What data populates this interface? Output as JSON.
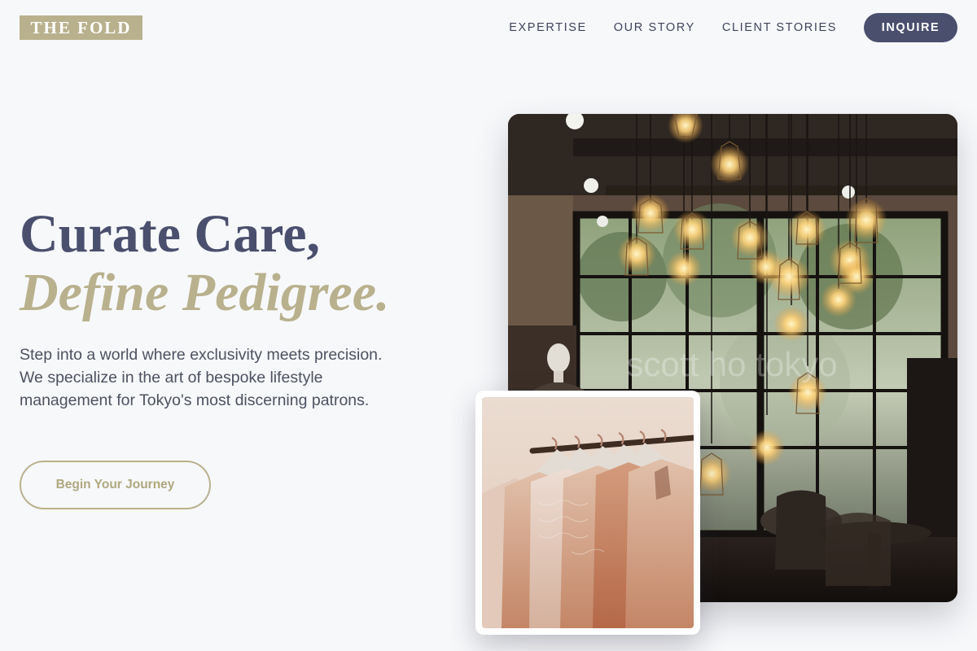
{
  "header": {
    "logo": "THE FOLD",
    "nav": [
      {
        "label": "EXPERTISE"
      },
      {
        "label": "OUR STORY"
      },
      {
        "label": "CLIENT STORIES"
      }
    ],
    "cta": "INQUIRE"
  },
  "hero": {
    "title_line1": "Curate Care,",
    "title_line2": "Define Pedigree.",
    "description": "Step into a world where exclusivity meets precision. We specialize in the art of bespoke lifestyle management for Tokyo's most discerning patrons.",
    "button": "Begin Your Journey"
  },
  "images": {
    "main": {
      "subject": "boutique interior with hanging edison bulbs",
      "watermark": "scott ho tokyo"
    },
    "secondary": {
      "subject": "clothing rack with pink dresses"
    }
  },
  "colors": {
    "background": "#f7f8fa",
    "navy": "#4a4f6d",
    "gold": "#b9b18d",
    "text": "#4d5260"
  }
}
